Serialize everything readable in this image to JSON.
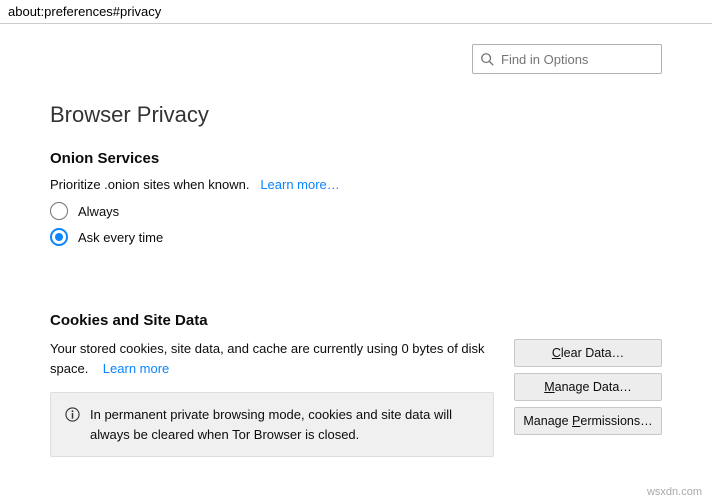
{
  "url": "about:preferences#privacy",
  "search": {
    "placeholder": "Find in Options"
  },
  "page_title": "Browser Privacy",
  "onion": {
    "heading": "Onion Services",
    "desc": "Prioritize .onion sites when known.",
    "learn_more": "Learn more…",
    "options": {
      "always": "Always",
      "ask": "Ask every time"
    }
  },
  "cookies": {
    "heading": "Cookies and Site Data",
    "desc_part1": "Your stored cookies, site data, and cache are currently using 0 bytes of disk space.",
    "learn_more": "Learn more",
    "info": "In permanent private browsing mode, cookies and site data will always be cleared when Tor Browser is closed.",
    "buttons": {
      "clear": "Clear Data…",
      "manage": "Manage Data…",
      "permissions": "Manage Permissions…"
    }
  },
  "watermark": "wsxdn.com"
}
